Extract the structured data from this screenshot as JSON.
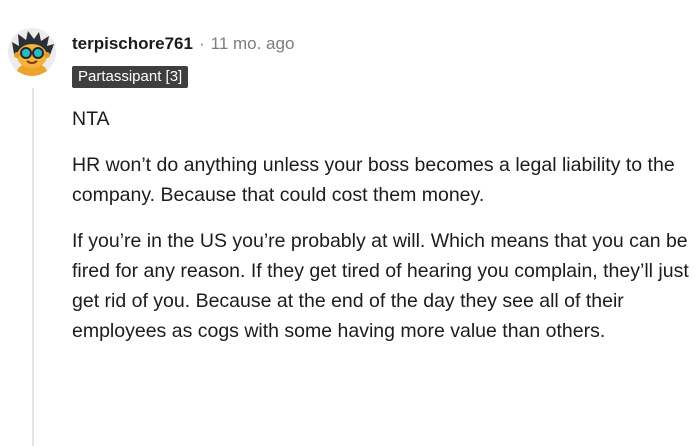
{
  "comment": {
    "author": "terpischore761",
    "separator": "·",
    "time": "11 mo. ago",
    "flair": "Partassipant [3]",
    "paragraphs": [
      "NTA",
      "HR won’t do anything unless your boss becomes a legal liability to the company. Because that could cost them money.",
      "If you’re in the US you’re probably at will. Which means that you can be fired for any reason. If they get tired of hearing you complain, they’ll just get rid of you. Because at the end of the day they see all of their employees as cogs with some having more value than others."
    ],
    "avatar_icon": "snoo-avatar-icon"
  },
  "colors": {
    "text": "#1c1c1c",
    "meta": "#7c7c7c",
    "flair_bg": "#3f3f3f",
    "flair_text": "#ffffff",
    "thread_line": "#e5e5e5"
  }
}
